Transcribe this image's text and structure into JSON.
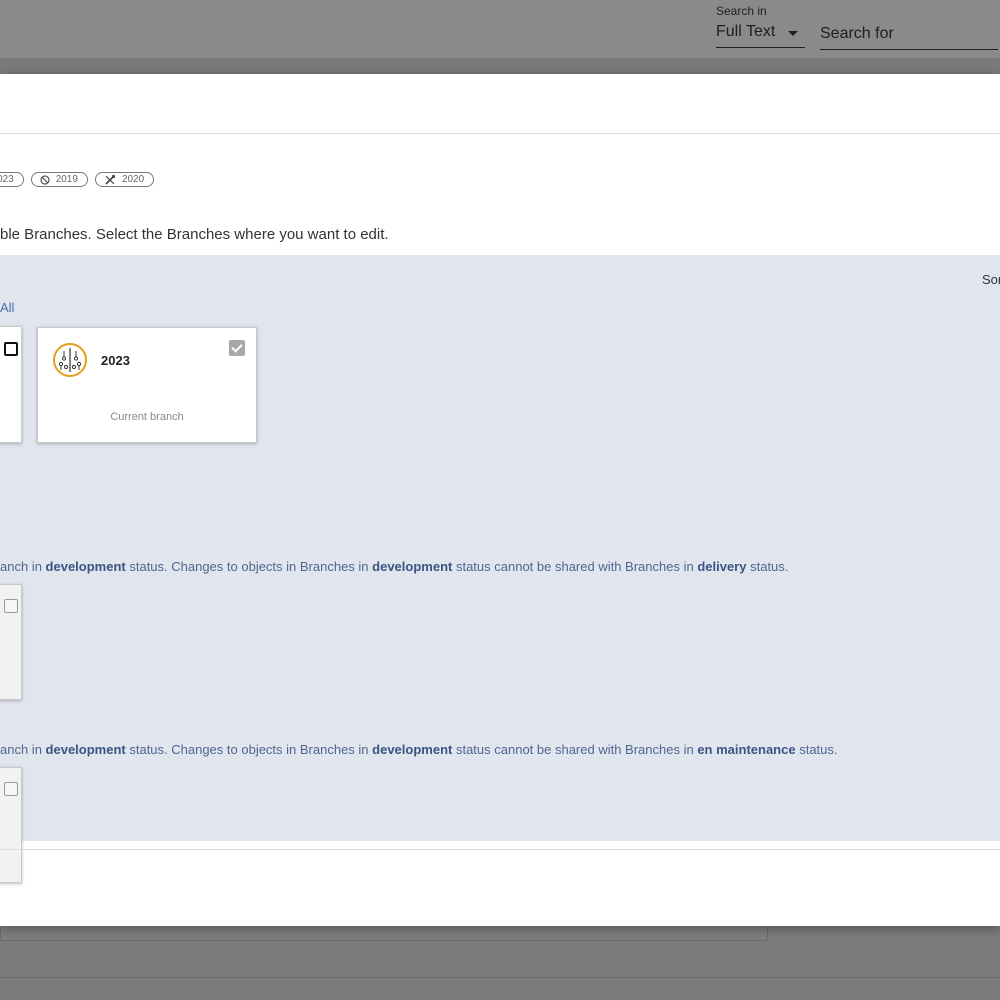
{
  "search": {
    "search_in_label": "Search in",
    "search_in_value": "Full Text",
    "search_for_placeholder": "Search for"
  },
  "modal": {
    "chips": [
      {
        "label": "023",
        "icon": "none"
      },
      {
        "label": "2019",
        "icon": "blocked-icon"
      },
      {
        "label": "2020",
        "icon": "tools-icon"
      }
    ],
    "instruction": "ble Branches. Select the Branches where you want to edit.",
    "sort_label": "Sor",
    "select_all_label": "All",
    "current_card": {
      "name": "2023",
      "caption": "Current branch",
      "checked": true
    },
    "notice_1": {
      "p1": "anch in ",
      "b1": "development",
      "p2": " status. Changes to objects in Branches in ",
      "b2": "development",
      "p3": " status cannot be shared with Branches in ",
      "b3": "delivery",
      "p4": " status."
    },
    "notice_2": {
      "p1": "anch in ",
      "b1": "development",
      "p2": " status. Changes to objects in Branches in ",
      "b2": "development",
      "p3": " status cannot be shared with Branches in ",
      "b3": "en maintenance",
      "p4": " status."
    }
  },
  "colors": {
    "panel_bg": "#e1e5ee",
    "notice_text": "#4d6790",
    "logo_ring": "#e89a1f"
  }
}
